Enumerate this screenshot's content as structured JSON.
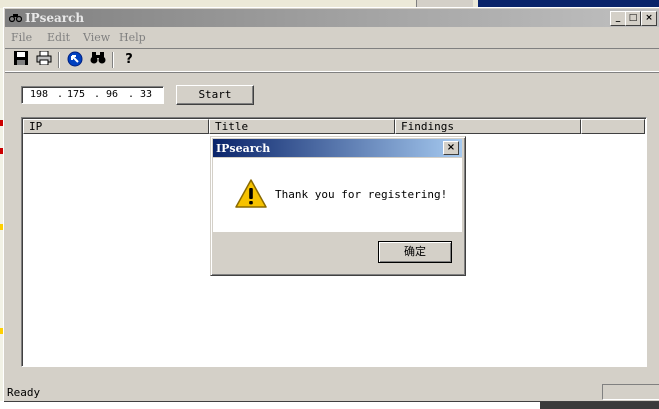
{
  "window": {
    "title": "IPsearch",
    "controls": {
      "minimize": "_",
      "maximize": "□",
      "close": "×"
    }
  },
  "menu": [
    "File",
    "Edit",
    "View",
    "Help"
  ],
  "toolbar": {
    "icons": [
      "save-icon",
      "print-icon",
      "navigate-icon",
      "binoculars-icon",
      "help-icon"
    ]
  },
  "ip": {
    "oct1": "198",
    "oct2": "175",
    "oct3": "96",
    "oct4": "33",
    "sep": "."
  },
  "start_label": "Start",
  "columns": [
    "IP",
    "Title",
    "Findings"
  ],
  "status": {
    "text": "Ready"
  },
  "dialog": {
    "title": "IPsearch",
    "message": "Thank you for registering!",
    "ok_label": "确定",
    "icon": "warning-icon"
  }
}
